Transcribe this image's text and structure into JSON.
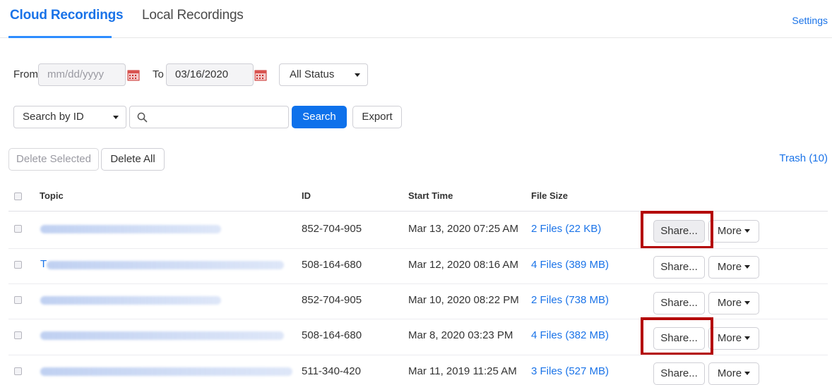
{
  "tabs": [
    {
      "label": "Cloud Recordings",
      "active": true
    },
    {
      "label": "Local Recordings",
      "active": false
    }
  ],
  "settings_label": "Settings",
  "filters": {
    "from_label": "From",
    "from_placeholder": "mm/dd/yyyy",
    "to_label": "To",
    "to_value": "03/16/2020",
    "status_value": "All Status",
    "search_by_value": "Search by ID",
    "search_placeholder": "",
    "search_label": "Search",
    "export_label": "Export"
  },
  "actions": {
    "delete_selected_label": "Delete Selected",
    "delete_all_label": "Delete All",
    "trash_label": "Trash (10)"
  },
  "table": {
    "headers": {
      "topic": "Topic",
      "id": "ID",
      "start_time": "Start Time",
      "file_size": "File Size"
    },
    "share_label": "Share...",
    "more_label": "More",
    "rows": [
      {
        "topic_prefix": "",
        "id": "852-704-905",
        "start_time": "Mar 13, 2020 07:25 AM",
        "file_size": "2 Files (22 KB)",
        "share_highlighted": true
      },
      {
        "topic_prefix": "T",
        "id": "508-164-680",
        "start_time": "Mar 12, 2020 08:16 AM",
        "file_size": "4 Files (389 MB)",
        "share_highlighted": false
      },
      {
        "topic_prefix": "",
        "id": "852-704-905",
        "start_time": "Mar 10, 2020 08:22 PM",
        "file_size": "2 Files (738 MB)",
        "share_highlighted": false
      },
      {
        "topic_prefix": "",
        "id": "508-164-680",
        "start_time": "Mar 8, 2020 03:23 PM",
        "file_size": "4 Files (382 MB)",
        "share_highlighted": true
      },
      {
        "topic_prefix": "",
        "id": "511-340-420",
        "start_time": "Mar 11, 2019 11:25 AM",
        "file_size": "3 Files (527 MB)",
        "share_highlighted": false
      }
    ]
  },
  "colors": {
    "accent": "#1a73e8",
    "primary_button": "#0e71eb",
    "highlight_box": "#b40404"
  },
  "icons": {
    "calendar": "calendar-icon",
    "search": "magnifier-icon",
    "dropdown": "chevron-down-icon"
  }
}
